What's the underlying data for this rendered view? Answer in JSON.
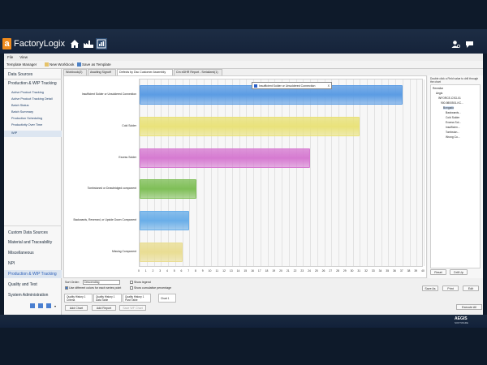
{
  "header": {
    "logo_letter": "a",
    "brand": "FactoryLogix"
  },
  "menu": [
    "File",
    "View"
  ],
  "toolbar": {
    "template_manager": "Template Manager",
    "new_workbook": "New Workbook",
    "save_as_template": "Save as Template"
  },
  "sidebar": {
    "data_sources": "Data Sources",
    "section": "Production & WIP Tracking",
    "items": [
      "Active Product Tracking",
      "Active Product Tracking Detail",
      "Batch Status",
      "Batch Summary",
      "Production Scheduling",
      "Productivity Over Time",
      "WIP"
    ],
    "bottom_items": [
      "Custom Data Sources",
      "Material and Traceability",
      "Miscellaneous",
      "NPI",
      "Production & WIP Tracking",
      "Quality and Test",
      "System Administration"
    ]
  },
  "tabs": [
    "Workbook(2)",
    "Awaiting Signoff",
    "Defects by Dsc Customer Assembly",
    "Cm eDHR Report - Serialized(1)"
  ],
  "chart_data": {
    "type": "bar",
    "orientation": "horizontal",
    "categories": [
      "Insufficient Solder or Unsoldered Connection",
      "Cold Solder",
      "Excess Solder",
      "Tombstoned or Drawbridged component",
      "Backwards, Reversed, or Upside Down Component",
      "Missing Component"
    ],
    "values": [
      37,
      31,
      24,
      8,
      7,
      6
    ],
    "colors": [
      "#5b9ce4",
      "#e9e27a",
      "#d67ad1",
      "#7fbf57",
      "#6aaee8",
      "#e9dd93"
    ],
    "xticks": [
      0,
      1,
      2,
      3,
      4,
      5,
      6,
      7,
      8,
      9,
      10,
      11,
      12,
      13,
      14,
      15,
      16,
      17,
      18,
      19,
      20,
      21,
      22,
      23,
      24,
      25,
      26,
      27,
      28,
      29,
      30,
      31,
      32,
      33,
      34,
      35,
      36,
      37,
      38,
      39,
      40
    ],
    "xlim": [
      0,
      40
    ],
    "grid": true,
    "tooltip": "Insufficient Solder or Unsoldered Connection"
  },
  "tooltip_close": "X",
  "right": {
    "instruction": "Double click a Field value to drill through the chart",
    "tree": [
      "Remsllar",
      "Aegis",
      "INFORCE-CSG-01",
      "900-9800501-KC...",
      "Bongado",
      "Backwards...",
      "Cold Solder",
      "Excess Sol...",
      "Insufficien...",
      "Tombston...",
      "Wrong Co..."
    ],
    "reset": "Reset",
    "drill_up": "Drill Up"
  },
  "options": {
    "sort_order_label": "Sort Order:",
    "sort_order_value": "Descending",
    "use_colors": "Use different colors for each series point",
    "show_legend": "Show legend",
    "show_cumulative": "Show cumulative percentage",
    "save_as": "Save As",
    "print": "Print",
    "edit": "Edit"
  },
  "bottom_tabs": [
    "Quality History 1 Criteria",
    "Quality History 1 Data Table",
    "Quality History 1 Pivot Table",
    "Chart 1"
  ],
  "footer_buttons": {
    "add_chart": "Add Chart",
    "add_report": "Add Report",
    "save_wf_chart": "Save WF Chart",
    "execute_all": "Execute All"
  },
  "brand_footer": {
    "name": "AEGIS",
    "sub": "SOFTWARE"
  }
}
